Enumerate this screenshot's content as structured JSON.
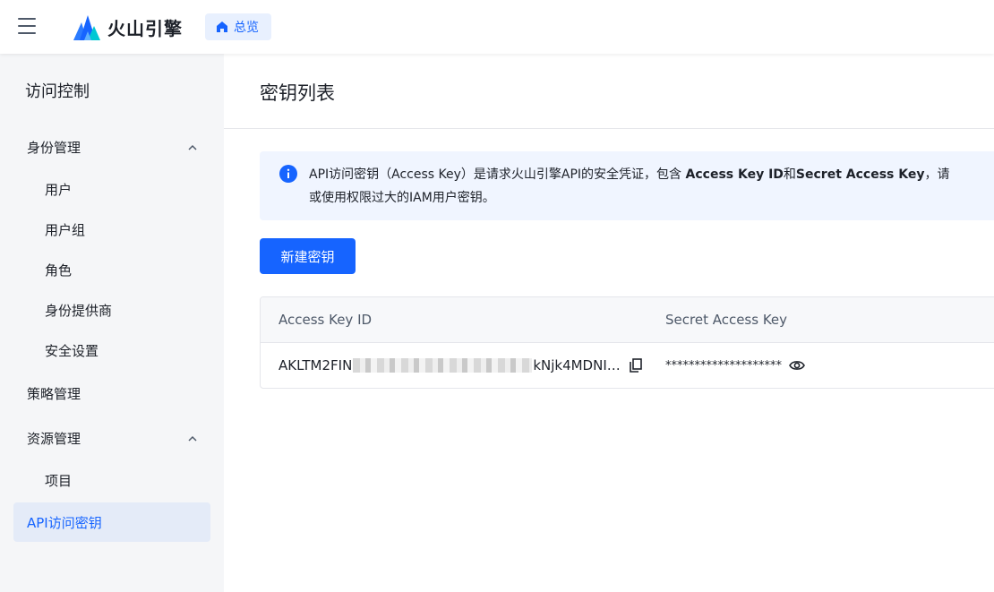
{
  "header": {
    "brand": "火山引擎",
    "overview_label": "总览"
  },
  "sidebar": {
    "title": "访问控制",
    "groups": [
      {
        "label": "身份管理",
        "items": [
          "用户",
          "用户组",
          "角色",
          "身份提供商",
          "安全设置"
        ]
      },
      {
        "label": "策略管理"
      },
      {
        "label": "资源管理",
        "items": [
          "项目"
        ]
      }
    ],
    "active_item": "API访问密钥"
  },
  "main": {
    "title": "密钥列表",
    "alert": {
      "text_prefix": "API访问密钥（Access Key）是请求火山引擎API的安全凭证，包含 ",
      "bold_1": "Access Key ID",
      "connector": "和",
      "bold_2": "Secret Access Key",
      "text_suffix": "，请",
      "line2": "或使用权限过大的IAM用户密钥。"
    },
    "create_button": "新建密钥",
    "table": {
      "columns": [
        "Access Key ID",
        "Secret Access Key"
      ],
      "rows": [
        {
          "access_key_prefix": "AKLTM2FIN",
          "access_key_suffix": "kNjk4MDNI…",
          "secret_masked": "********************"
        }
      ]
    }
  },
  "colors": {
    "primary": "#1664ff",
    "sidebar_bg": "#f5f6f8",
    "alert_bg": "#f0f5ff"
  }
}
